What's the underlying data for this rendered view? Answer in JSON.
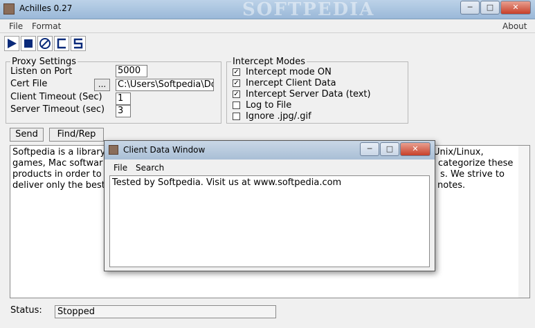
{
  "window": {
    "title": "Achilles 0.27",
    "watermark": "SOFTPEDIA",
    "minimize": "─",
    "maximize": "□",
    "close": "✕"
  },
  "menu": {
    "file": "File",
    "format": "Format",
    "about": "About"
  },
  "toolbar": {
    "icons": [
      "play-icon",
      "stop-icon",
      "no-icon",
      "c-icon",
      "s-icon"
    ]
  },
  "proxy": {
    "legend": "Proxy Settings",
    "listen_label": "Listen on Port",
    "listen_value": "5000",
    "cert_label": "Cert File",
    "cert_browse": "...",
    "cert_value": "C:\\Users\\Softpedia\\Do",
    "client_timeout_label": "Client Timeout (Sec)",
    "client_timeout_value": "1",
    "server_timeout_label": "Server Timeout (sec)",
    "server_timeout_value": "3"
  },
  "intercept": {
    "legend": "Intercept Modes",
    "options": [
      {
        "label": "Intercept mode ON",
        "checked": true
      },
      {
        "label": "Inercept Client Data",
        "checked": true
      },
      {
        "label": "Intercept Server Data (text)",
        "checked": true
      },
      {
        "label": "Log to File",
        "checked": false
      },
      {
        "label": "Ignore .jpg/.gif",
        "checked": false
      }
    ],
    "check_mark": "✓"
  },
  "actions": {
    "send": "Send",
    "find": "Find/Rep"
  },
  "main_text": {
    "line1_start": "Softpedia is a library",
    "line1_end": "Unix/Linux,",
    "line2_start": "games, Mac softwar",
    "line2_end": "categorize these",
    "line3_start": "products in order to",
    "line3_end": "s. We strive to",
    "line4_start": "deliver only the best",
    "line4_end": "notes."
  },
  "status": {
    "label": "Status:",
    "value": "Stopped"
  },
  "client_window": {
    "title": "Client Data Window",
    "menu_file": "File",
    "menu_search": "Search",
    "content": "Tested by Softpedia. Visit us at www.softpedia.com"
  }
}
